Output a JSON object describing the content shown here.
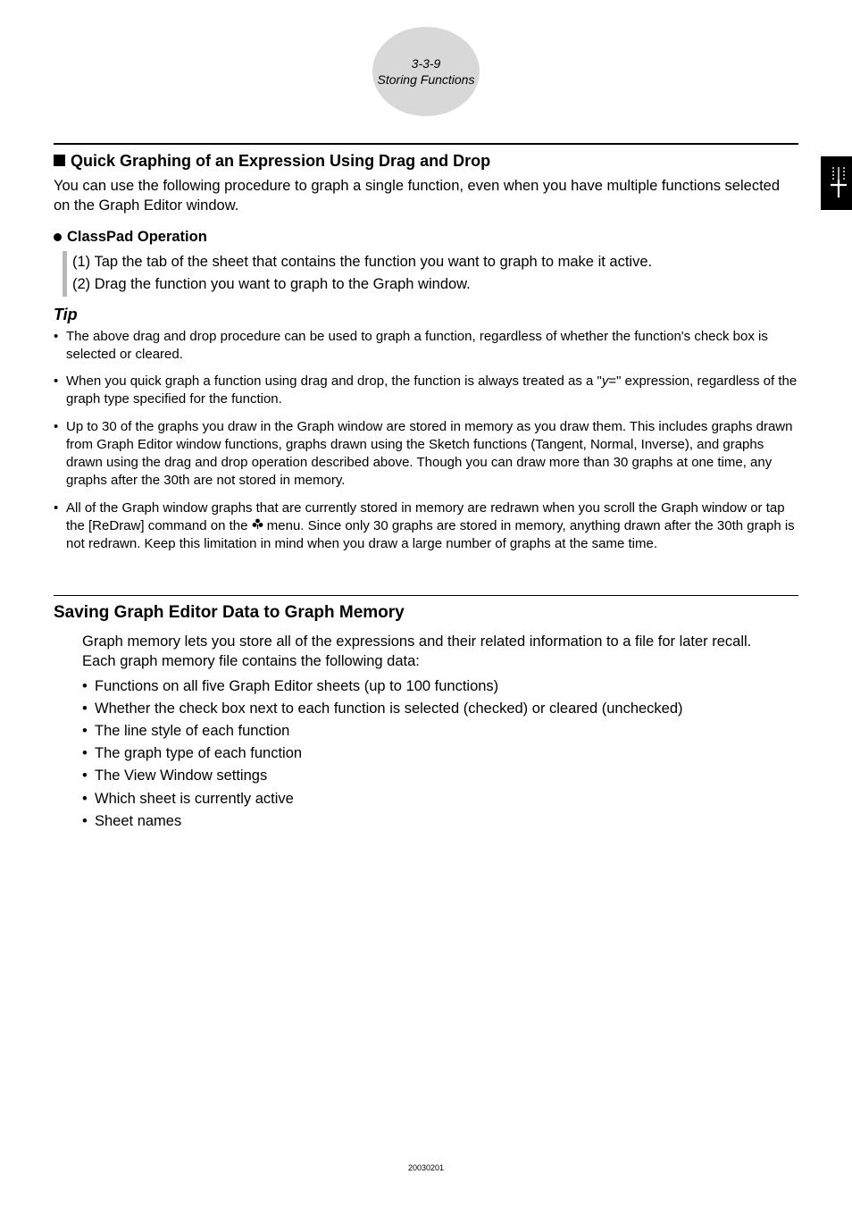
{
  "header": {
    "page_ref": "3-3-9",
    "page_title": "Storing Functions"
  },
  "section1": {
    "heading": "Quick Graphing of an Expression Using Drag and Drop",
    "intro": "You can use the following procedure to graph a single function, even when you have multiple functions selected on the Graph Editor window.",
    "op_heading": "ClassPad Operation",
    "step1": "(1) Tap the tab of the sheet that contains the function you want to graph to make it active.",
    "step2": "(2) Drag the function you want to graph to the Graph window."
  },
  "tip": {
    "label": "Tip",
    "items": [
      "The above drag and drop procedure can be used to graph a function, regardless of whether the function's check box is selected or cleared.",
      "When you quick graph a function using drag and drop, the function is always treated as a \"y=\" expression, regardless of the graph type specified for the function.",
      "Up to 30 of the graphs you draw in the Graph window are stored in memory as you draw them. This includes graphs drawn from Graph Editor window functions, graphs drawn using the Sketch functions (Tangent, Normal, Inverse), and graphs drawn using the drag and drop operation described above. Though you can draw more than 30 graphs at one time, any graphs after the 30th are not stored in memory.",
      "All of the Graph window graphs that are currently stored in memory are redrawn when you scroll the Graph window or tap the [ReDraw] command on the ♣ menu. Since only 30 graphs are stored in memory, anything drawn after the 30th graph is not redrawn. Keep this limitation in mind when you draw a large number of graphs at the same time."
    ]
  },
  "section2": {
    "heading": "Saving Graph Editor Data to Graph Memory",
    "para1": "Graph memory lets you store all of the expressions and their related information to a file for later recall.",
    "para2": "Each graph memory file contains the following data:",
    "items": [
      "Functions on all five Graph Editor sheets (up to 100 functions)",
      "Whether the check box next to each function is selected (checked) or cleared (unchecked)",
      "The line style of each function",
      "The graph type of each function",
      "The View Window settings",
      "Which sheet is currently active",
      "Sheet names"
    ]
  },
  "footer": {
    "code": "20030201"
  }
}
